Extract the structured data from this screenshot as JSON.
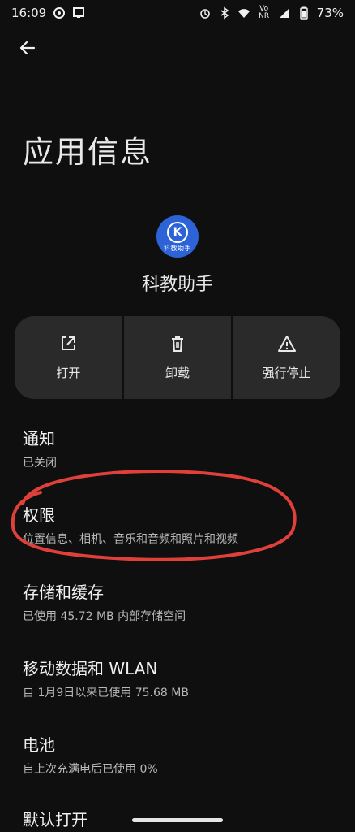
{
  "status_bar": {
    "time": "16:09",
    "network_text": "Vo NR",
    "battery_percent": "73%",
    "icons": [
      "alarm-icon",
      "bluetooth-icon",
      "wifi-icon",
      "signal-icon",
      "battery-icon"
    ]
  },
  "header": {
    "back_icon": "arrow-left-icon",
    "title": "应用信息"
  },
  "app": {
    "name": "科教助手",
    "icon_mark": "K",
    "icon_text": "科教助手",
    "icon_color": "#2c63d6"
  },
  "actions": [
    {
      "label": "打开",
      "icon": "open-external-icon"
    },
    {
      "label": "卸载",
      "icon": "trash-icon"
    },
    {
      "label": "强行停止",
      "icon": "warning-icon"
    }
  ],
  "settings": [
    {
      "title": "通知",
      "subtitle": "已关闭"
    },
    {
      "title": "权限",
      "subtitle": "位置信息、相机、音乐和音频和照片和视频"
    },
    {
      "title": "存储和缓存",
      "subtitle": "已使用 45.72 MB 内部存储空间"
    },
    {
      "title": "移动数据和 WLAN",
      "subtitle": "自 1月9日以来已使用 75.68 MB"
    },
    {
      "title": "电池",
      "subtitle": "自上次充满电后已使用 0%"
    },
    {
      "title": "默认打开",
      "subtitle": ""
    }
  ],
  "colors": {
    "background": "#0f0f0f",
    "card": "#2a2a2a",
    "annotation": "#e0403a"
  }
}
